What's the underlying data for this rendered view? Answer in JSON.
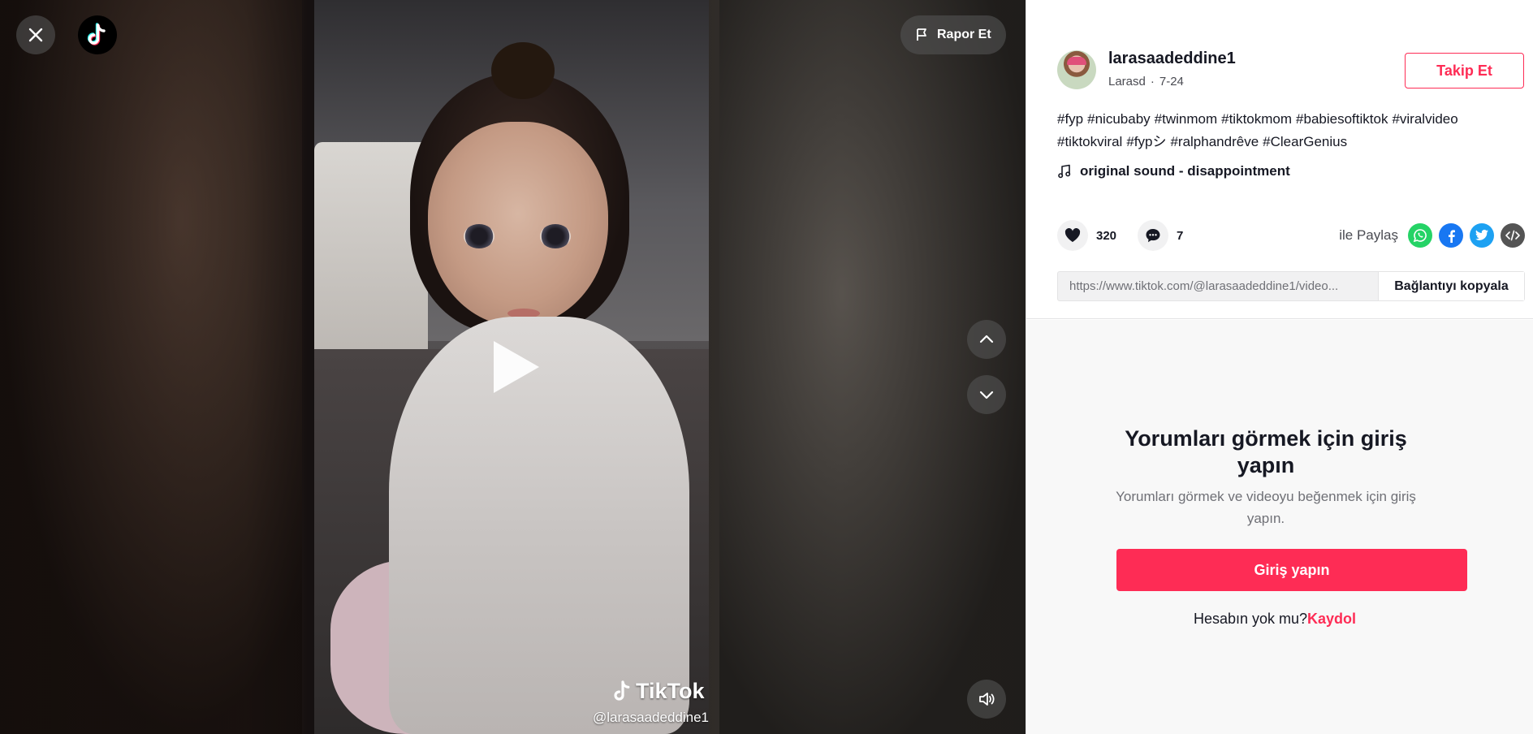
{
  "topbar": {
    "report_label": "Rapor Et"
  },
  "video": {
    "watermark_brand": "TikTok",
    "watermark_handle": "@larasaadeddine1"
  },
  "profile": {
    "username": "larasaadeddine1",
    "nickname": "Larasd",
    "separator": "·",
    "date": "7-24",
    "follow_label": "Takip Et"
  },
  "description": {
    "hashtags": [
      "#fyp",
      "#nicubaby",
      "#twinmom",
      "#tiktokmom",
      "#babiesoftiktok",
      "#viralvideo",
      "#tiktokviral",
      "#fypシ",
      "#ralphandrêve",
      "#ClearGenius"
    ]
  },
  "music": {
    "title": "original sound - disappointment"
  },
  "stats": {
    "likes": "320",
    "comments": "7"
  },
  "share": {
    "label": "ile Paylaş"
  },
  "link": {
    "url": "https://www.tiktok.com/@larasaadeddine1/video...",
    "copy_label": "Bağlantıyı kopyala"
  },
  "comments_gate": {
    "title": "Yorumları görmek için giriş yapın",
    "subtitle": "Yorumları görmek ve videoyu beğenmek için giriş yapın.",
    "login_label": "Giriş yapın",
    "no_account": "Hesabın yok mu?",
    "signup_label": "Kaydol"
  },
  "colors": {
    "accent": "#fe2c55",
    "whatsapp": "#25d366",
    "facebook": "#1877f2",
    "twitter": "#1da1f2",
    "embed": "#545454"
  },
  "icons": [
    "close-icon",
    "tiktok-logo-icon",
    "flag-icon",
    "play-icon",
    "chevron-up-icon",
    "chevron-down-icon",
    "volume-icon",
    "music-note-icon",
    "heart-icon",
    "comment-icon",
    "whatsapp-icon",
    "facebook-icon",
    "twitter-icon",
    "embed-icon"
  ]
}
